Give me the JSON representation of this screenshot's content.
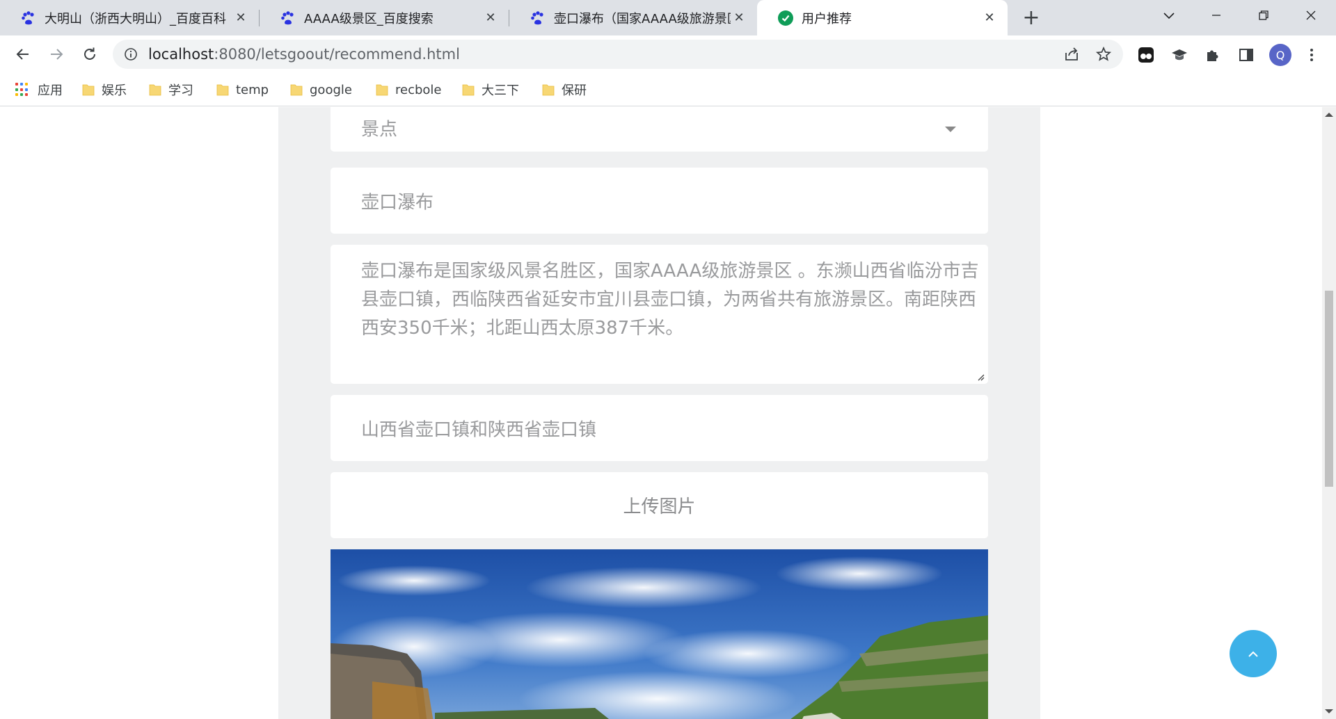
{
  "browser": {
    "tabs": [
      {
        "title": "大明山（浙西大明山）_百度百科",
        "favicon": "baidu-paw-icon",
        "active": false
      },
      {
        "title": "AAAA级景区_百度搜索",
        "favicon": "baidu-paw-icon",
        "active": false
      },
      {
        "title": "壶口瀑布（国家AAAA级旅游景区",
        "favicon": "baidu-paw-icon",
        "active": false
      },
      {
        "title": "用户推荐",
        "favicon": "green-check-icon",
        "active": true
      }
    ],
    "close_glyph": "✕",
    "new_tab_glyph": "+",
    "window_controls": {
      "dropdown": "⌵",
      "minimize": "—",
      "restore": "❐",
      "close": "✕"
    },
    "address": {
      "host": "localhost",
      "rest": ":8080/letsgoout/recommend.html"
    },
    "profile_initial": "Q"
  },
  "bookmarks": [
    {
      "label": "应用",
      "type": "apps"
    },
    {
      "label": "娱乐",
      "type": "folder"
    },
    {
      "label": "学习",
      "type": "folder"
    },
    {
      "label": "temp",
      "type": "folder"
    },
    {
      "label": "google",
      "type": "folder"
    },
    {
      "label": "recbole",
      "type": "folder"
    },
    {
      "label": "大三下",
      "type": "folder"
    },
    {
      "label": "保研",
      "type": "folder"
    }
  ],
  "form": {
    "category_select": {
      "value": "景点"
    },
    "name_input": {
      "value": "壶口瀑布"
    },
    "description": {
      "value": "壶口瀑布是国家级风景名胜区，国家AAAA级旅游景区 。东濒山西省临汾市吉县壶口镇，西临陕西省延安市宜川县壶口镇，为两省共有旅游景区。南距陕西西安350千米；北距山西太原387千米。"
    },
    "location_input": {
      "value": "山西省壶口镇和陕西省壶口镇"
    },
    "upload_button": "上传图片"
  },
  "colors": {
    "tabstrip_bg": "#dee1e6",
    "panel_bg": "#eff0f1",
    "placeholder_text": "#999a9c",
    "back_to_top": "#3db1e8",
    "profile": "#5865c7"
  }
}
